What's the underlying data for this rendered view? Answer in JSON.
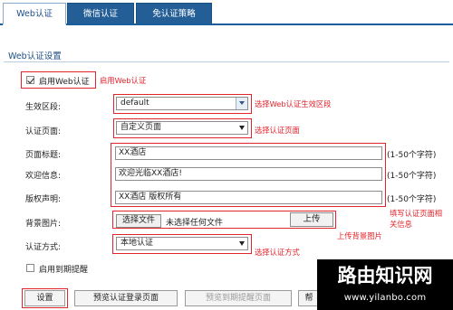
{
  "tabs": [
    {
      "label": "Web认证",
      "active": true
    },
    {
      "label": "微信认证",
      "active": false
    },
    {
      "label": "免认证策略",
      "active": false
    }
  ],
  "section_title": "Web认证设置",
  "enable_web_auth": {
    "label": "启用Web认证",
    "checked": true,
    "annotation": "启用Web认证"
  },
  "zone": {
    "label": "生效区段:",
    "value": "default",
    "annotation": "选择Web认证生效区段"
  },
  "auth_page": {
    "label": "认证页面:",
    "value": "自定义页面",
    "annotation": "选择认证页面"
  },
  "page_title": {
    "label": "页面标题:",
    "value": "XX酒店",
    "hint": "(1-50个字符)"
  },
  "welcome": {
    "label": "欢迎信息:",
    "value": "欢迎光临XX酒店!",
    "hint": "(1-50个字符)"
  },
  "copyright": {
    "label": "版权声明:",
    "value": "XX酒店 版权所有",
    "hint": "(1-50个字符)"
  },
  "fields_annotation": [
    "填写认证页面相",
    "关信息"
  ],
  "background": {
    "label": "背景图片:",
    "choose_button": "选择文件",
    "no_file_text": "未选择任何文件",
    "upload_button": "上传",
    "annotation": "上传背景图片"
  },
  "auth_method": {
    "label": "认证方式:",
    "value": "本地认证",
    "annotation": "选择认证方式"
  },
  "enable_expire_reminder": {
    "label": "启用到期提醒",
    "checked": false
  },
  "buttons": {
    "settings": "设置",
    "preview_login": "预览认证登录页面",
    "preview_expire": "预览到期提醒页面",
    "help": "帮"
  },
  "watermark": {
    "title": "路由知识网",
    "url": "www.yilanbo.com"
  },
  "colors": {
    "accent": "#235e96",
    "annotation_red": "#e2242c"
  }
}
